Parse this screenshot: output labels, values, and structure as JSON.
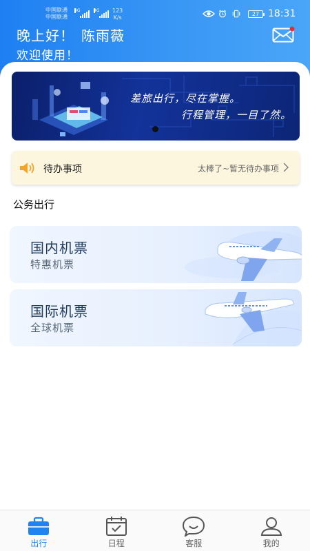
{
  "status_bar": {
    "carrier_1": "中国联通",
    "carrier_2": "中国联通",
    "network_1": "4G",
    "network_2": "4G",
    "speed_value": "123",
    "speed_unit": "K/s",
    "battery": "27",
    "time": "18:31"
  },
  "header": {
    "greeting": "晚上好！",
    "user_name": "陈雨薇",
    "welcome": "欢迎使用！"
  },
  "banner": {
    "line1": "差旅出行，尽在掌握。",
    "line2": "行程管理，一目了然。"
  },
  "todo": {
    "label": "待办事项",
    "status": "太棒了~暂无待办事项"
  },
  "section": {
    "title": "公务出行"
  },
  "cards": [
    {
      "title": "国内机票",
      "subtitle": "特惠机票"
    },
    {
      "title": "国际机票",
      "subtitle": "全球机票"
    }
  ],
  "tabs": [
    {
      "label": "出行",
      "icon": "briefcase-icon",
      "active": true
    },
    {
      "label": "日程",
      "icon": "calendar-icon",
      "active": false
    },
    {
      "label": "客服",
      "icon": "smile-chat-icon",
      "active": false
    },
    {
      "label": "我的",
      "icon": "user-icon",
      "active": false
    }
  ],
  "colors": {
    "header_blue": "#1e7ff2",
    "active_tab": "#1f84ef",
    "todo_bg": "#fdf6df",
    "banner_navy": "#0b1f6a"
  }
}
